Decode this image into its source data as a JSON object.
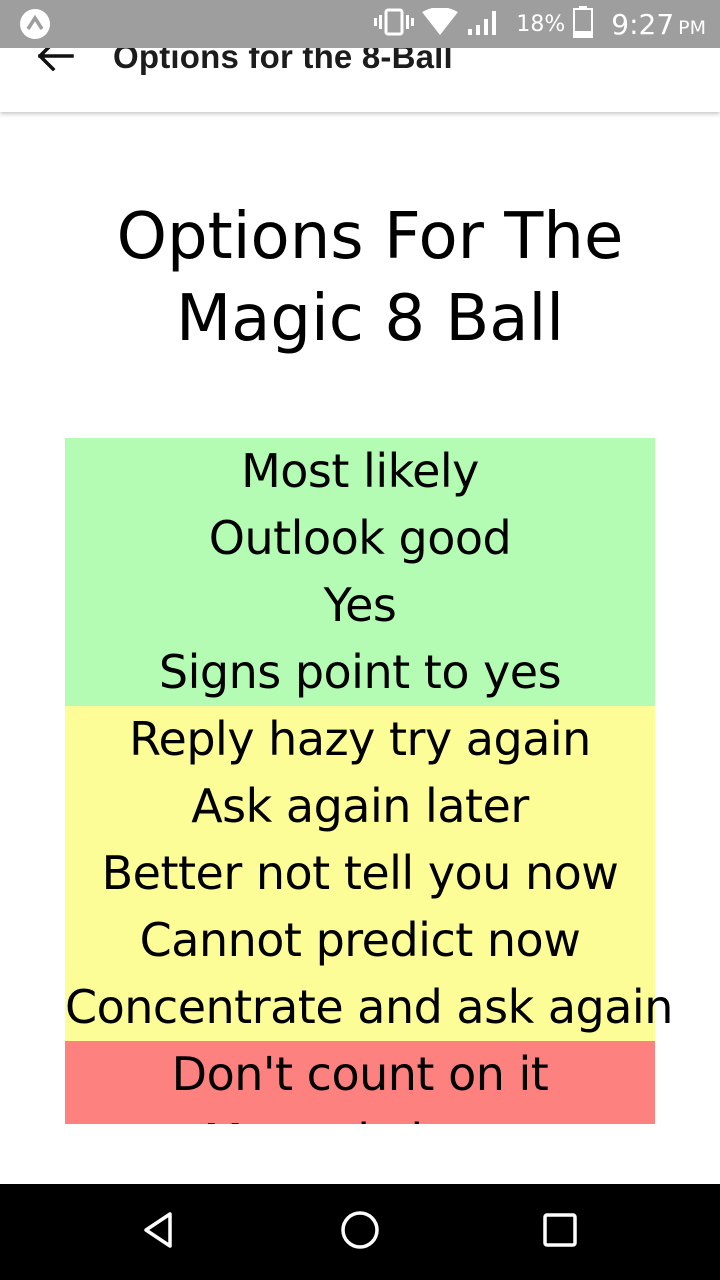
{
  "status_bar": {
    "notification_icon": "app-notification-icon",
    "vibrate_icon": "vibrate-icon",
    "wifi_icon": "wifi-icon",
    "signal_icon": "signal-icon",
    "battery_icon": "battery-icon",
    "battery_percent": "18%",
    "time": "9:27",
    "ampm": "PM"
  },
  "app_bar": {
    "back_icon": "arrow-left-icon",
    "title": "Options for the 8-Ball"
  },
  "content": {
    "heading_line1": "Options For The",
    "heading_line2": "Magic 8 Ball",
    "groups": {
      "positive": {
        "color": "#b4fcb4",
        "options": [
          "Most likely",
          "Outlook good",
          "Yes",
          "Signs point to yes"
        ]
      },
      "neutral": {
        "color": "#fdfd98",
        "options": [
          "Reply hazy try again",
          "Ask again later",
          "Better not tell you now",
          "Cannot predict now",
          "Concentrate and ask again"
        ]
      },
      "negative": {
        "color": "#fd817f",
        "options": [
          "Don't count on it",
          "My reply is no"
        ]
      }
    }
  },
  "nav_bar": {
    "back_icon": "triangle-back-icon",
    "home_icon": "circle-home-icon",
    "recents_icon": "square-recents-icon"
  }
}
